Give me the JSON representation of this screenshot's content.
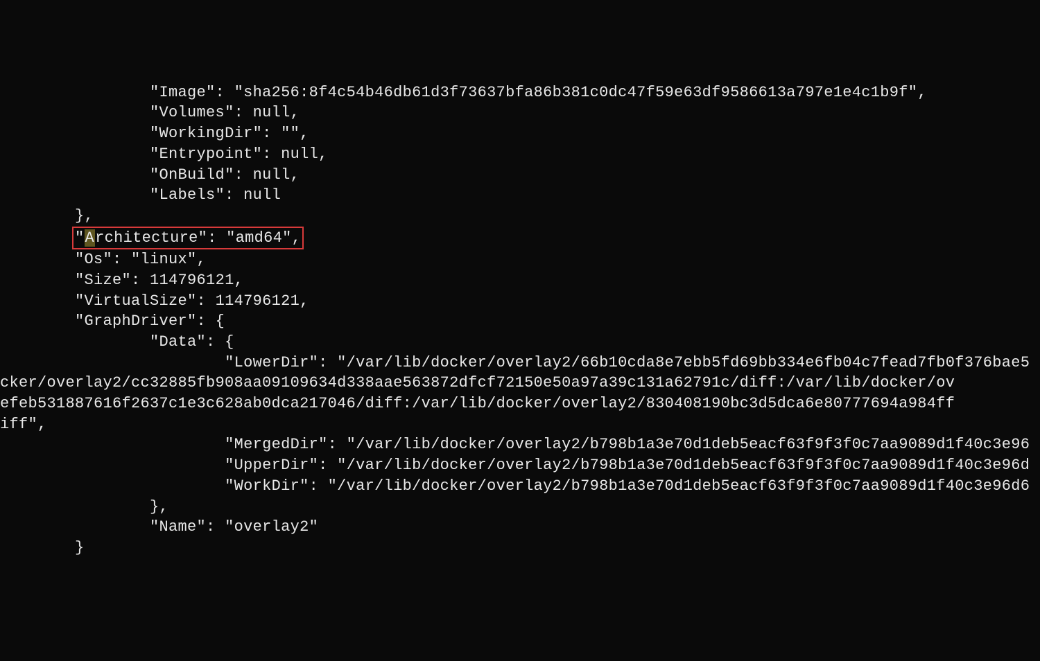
{
  "indent1": "        ",
  "indent2": "                ",
  "indent3": "                        ",
  "line_image": "\"Image\": \"sha256:8f4c54b46db61d3f73637bfa86b381c0dc47f59e63df9586613a797e1e4c1b9f\",",
  "line_volumes": "\"Volumes\": null,",
  "line_workingdir": "\"WorkingDir\": \"\",",
  "line_entrypoint": "\"Entrypoint\": null,",
  "line_onbuild": "\"OnBuild\": null,",
  "line_labels": "\"Labels\": null",
  "close_brace": "},",
  "architecture_pre": "\"",
  "architecture_mark": "A",
  "architecture_rest": "rchitecture\": \"amd64\",",
  "line_os": "\"Os\": \"linux\",",
  "line_size": "\"Size\": 114796121,",
  "line_virtualsize": "\"VirtualSize\": 114796121,",
  "line_graphdriver": "\"GraphDriver\": {",
  "line_data": "\"Data\": {",
  "line_lowerdir1": "\"LowerDir\": \"/var/lib/docker/overlay2/66b10cda8e7ebb5fd69bb334e6fb04c7fead7fb0f376bae5",
  "line_lowerdir2": "cker/overlay2/cc32885fb908aa09109634d338aae563872dfcf72150e50a97a39c131a62791c/diff:/var/lib/docker/ov",
  "line_lowerdir3": "efeb531887616f2637c1e3c628ab0dca217046/diff:/var/lib/docker/overlay2/830408190bc3d5dca6e80777694a984ff",
  "line_lowerdir4": "iff\",",
  "line_mergeddir": "\"MergedDir\": \"/var/lib/docker/overlay2/b798b1a3e70d1deb5eacf63f9f3f0c7aa9089d1f40c3e96",
  "line_upperdir": "\"UpperDir\": \"/var/lib/docker/overlay2/b798b1a3e70d1deb5eacf63f9f3f0c7aa9089d1f40c3e96d",
  "line_workdir": "\"WorkDir\": \"/var/lib/docker/overlay2/b798b1a3e70d1deb5eacf63f9f3f0c7aa9089d1f40c3e96d6",
  "line_name": "\"Name\": \"overlay2\"",
  "close_brace2": "}"
}
